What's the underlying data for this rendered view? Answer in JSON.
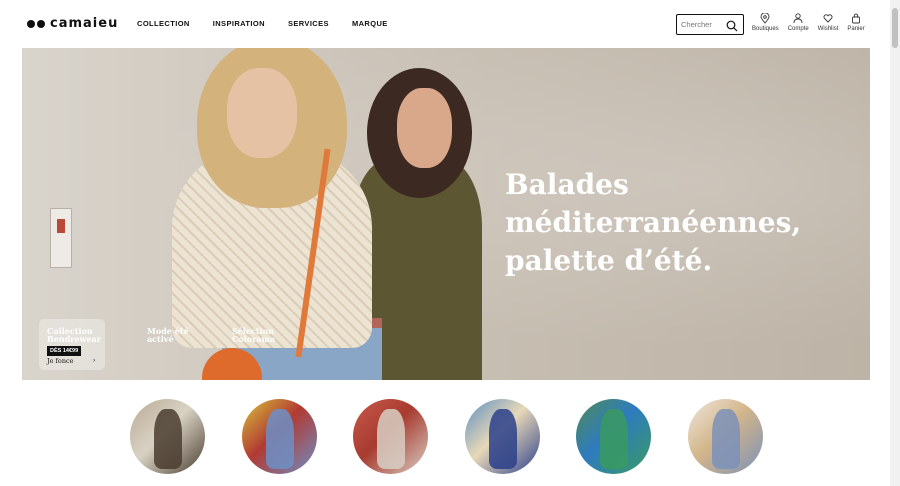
{
  "brand": {
    "name": "camaieu"
  },
  "nav": {
    "items": [
      "COLLECTION",
      "INSPIRATION",
      "SERVICES",
      "MARQUE"
    ]
  },
  "search": {
    "placeholder": "Chercher",
    "icon": "search-icon"
  },
  "tools": [
    {
      "label": "Boutiques",
      "icon": "map-pin-icon"
    },
    {
      "label": "Compte",
      "icon": "user-icon"
    },
    {
      "label": "Wishlist",
      "icon": "heart-icon"
    },
    {
      "label": "Panier",
      "icon": "bag-icon"
    }
  ],
  "hero": {
    "headline": [
      "Balades",
      "méditerranéennes,",
      "palette d’été."
    ],
    "cards": [
      {
        "title": [
          "Collection",
          "Bendrewear"
        ],
        "price": "DÈS 14€99",
        "cta": "Je fonce",
        "active": true
      },
      {
        "title": [
          "Mode été",
          "activé"
        ],
        "active": false
      },
      {
        "title": [
          "Sélection",
          "Colorama"
        ],
        "active": false
      }
    ]
  },
  "categories": [
    {
      "colors": [
        "#b8aa94",
        "#4a3d30",
        "#d9d2c4"
      ]
    },
    {
      "colors": [
        "#d9c43a",
        "#6d8fc6",
        "#b13a33"
      ]
    },
    {
      "colors": [
        "#c85a4a",
        "#d8cfc4",
        "#a83b30"
      ]
    },
    {
      "colors": [
        "#5d8fc2",
        "#2b3f8a",
        "#e7d8b8"
      ]
    },
    {
      "colors": [
        "#4f8b56",
        "#3a9a60",
        "#2e7bbf"
      ]
    },
    {
      "colors": [
        "#efe8de",
        "#7b91b8",
        "#d3b58a"
      ]
    }
  ],
  "colors": {
    "accent": "#111111",
    "hero_bg": "#cfc8be",
    "headline": "#ffffff"
  }
}
